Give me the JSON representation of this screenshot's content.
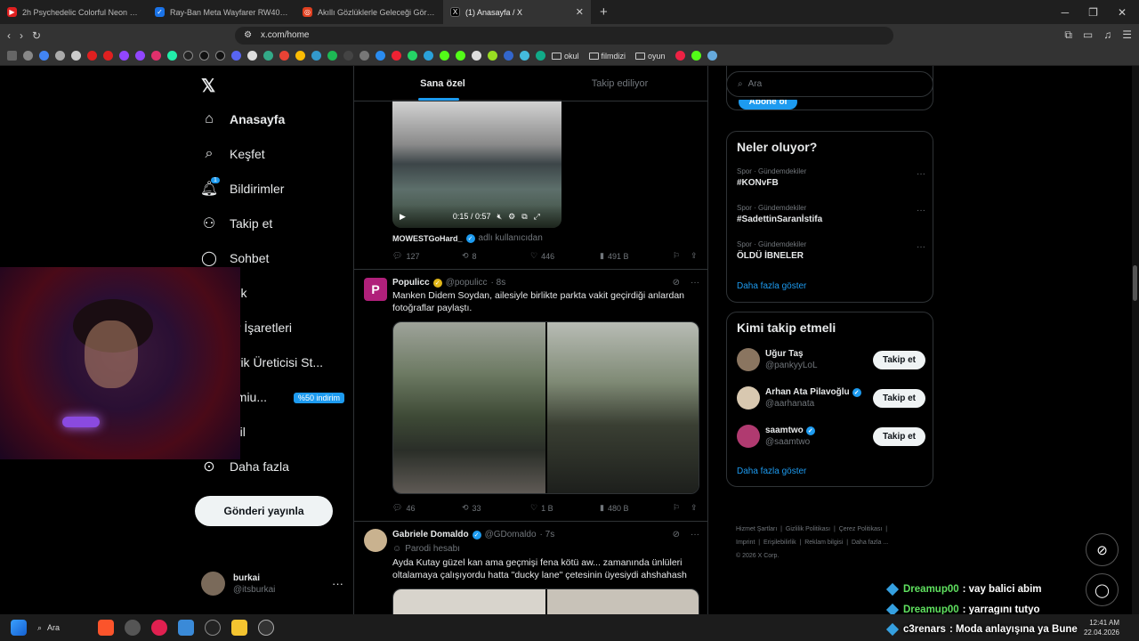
{
  "browser": {
    "tabs": [
      {
        "title": "2h Psychedelic Colorful Neon Backgr",
        "color": "#e02020"
      },
      {
        "title": "Ray-Ban Meta Wayfarer RW4006 601",
        "color": "#1a73e8"
      },
      {
        "title": "Akıllı Gözlüklerle Geleceği Gör! H",
        "color": "#e04020"
      },
      {
        "title": "(1) Anasayfa / X",
        "color": "#000000"
      }
    ],
    "url": "x.com/home",
    "bookmark_folders": [
      "okul",
      "filmdizi",
      "oyun"
    ]
  },
  "nav": {
    "items": [
      {
        "label": "Anasayfa",
        "icon": "home-icon"
      },
      {
        "label": "Keşfet",
        "icon": "search-icon"
      },
      {
        "label": "Bildirimler",
        "icon": "bell-icon",
        "badge": "1"
      },
      {
        "label": "Takip et",
        "icon": "person-plus-icon"
      },
      {
        "label": "Sohbet",
        "icon": "chat-icon"
      },
      {
        "label": "rok",
        "icon": "grok-icon"
      },
      {
        "label": "er İşaretleri",
        "icon": "bookmark-icon"
      },
      {
        "label": "erik Üreticisi St...",
        "icon": "creator-icon"
      },
      {
        "label": "emiu...",
        "icon": "premium-icon",
        "promo": "%50 indirim"
      },
      {
        "label": "ofil",
        "icon": "profile-icon"
      },
      {
        "label": "Daha fazla",
        "icon": "more-icon"
      }
    ],
    "post_button": "Gönderi yayınla",
    "user": {
      "name": "burkai",
      "handle": "@itsburkai"
    }
  },
  "feed": {
    "tabs": [
      "Sana özel",
      "Takip ediliyor"
    ],
    "video_post": {
      "time": "0:15 / 0:57",
      "credit_name": "MOWESTGoHard_",
      "credit_suffix": "adlı kullanıcıdan",
      "replies": "127",
      "reposts": "8",
      "likes": "446",
      "views": "491 B"
    },
    "post1": {
      "name": "Populicc",
      "handle": "@populicc",
      "time": "· 8s",
      "text": "Manken Didem Soydan, ailesiyle birlikte parkta vakit geçirdiği anlardan fotoğraflar paylaştı.",
      "replies": "46",
      "reposts": "33",
      "likes": "1 B",
      "views": "480 B"
    },
    "post2": {
      "name": "Gabriele Domaldo",
      "handle": "@GDomaldo",
      "time": "· 7s",
      "parody": "Parodi hesabı",
      "text": "Ayda Kutay güzel kan ama geçmişi fena kötü aw... zamanında ünlüleri oltalamaya çalışıyordu hatta \"ducky lane\" çetesinin üyesiydi ahshahash"
    }
  },
  "sidebar": {
    "search_placeholder": "Ara",
    "subscribe_label": "Abone ol",
    "trends_title": "Neler oluyor?",
    "trends": [
      {
        "category": "Spor · Gündemdekiler",
        "name": "#KONvFB"
      },
      {
        "category": "Spor · Gündemdekiler",
        "name": "#SadettinSaranİstifa"
      },
      {
        "category": "Spor · Gündemdekiler",
        "name": "ÖLDÜ İBNELER"
      }
    ],
    "show_more": "Daha fazla göster",
    "who_title": "Kimi takip etmeli",
    "who": [
      {
        "name": "Uğur Taş",
        "handle": "@pankyyLoL",
        "verified": false
      },
      {
        "name": "Arhan Ata Pilavoğlu",
        "handle": "@aarhanata",
        "verified": true
      },
      {
        "name": "saamtwo",
        "handle": "@saamtwo",
        "verified": true
      }
    ],
    "follow_label": "Takip et",
    "footer": [
      "Hizmet Şartları",
      "Gizlilik Politikası",
      "Çerez Politikası",
      "Imprint",
      "Erişilebilirlik",
      "Reklam bilgisi",
      "Daha fazla ...",
      "© 2026 X Corp."
    ]
  },
  "overlay_chat": [
    {
      "user": "Dreamup00",
      "msg": ": vay balici abim"
    },
    {
      "user": "Dreamup00",
      "msg": ": yarragını tutyo"
    },
    {
      "user": "c3renars",
      "msg": ": Moda anlayışına ya Bune"
    }
  ],
  "taskbar": {
    "search": "Ara",
    "time": "12:41 AM",
    "date": "22.04.2026"
  },
  "colors": {
    "accent": "#1d9bf0",
    "bg": "#000000",
    "border": "#2f3336",
    "muted": "#71767b"
  }
}
